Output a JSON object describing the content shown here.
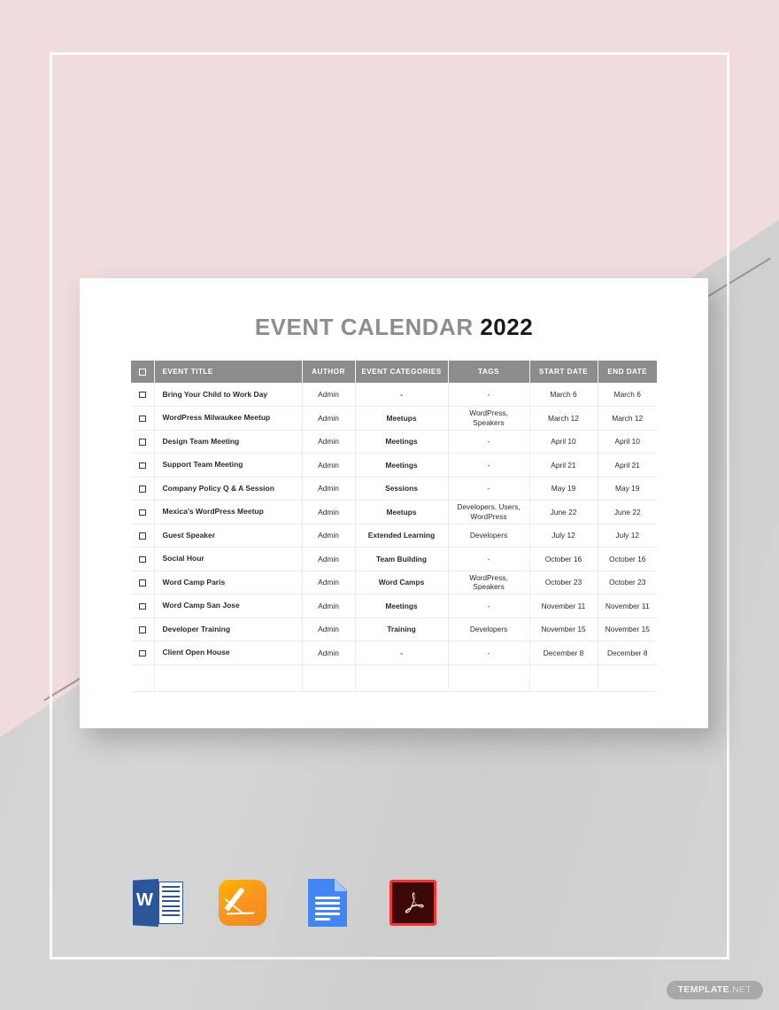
{
  "document": {
    "title_light": "EVENT CALENDAR",
    "title_dark": "2022"
  },
  "table": {
    "columns": [
      "EVENT TITLE",
      "AUTHOR",
      "EVENT CATEGORIES",
      "TAGS",
      "START DATE",
      "END DATE"
    ],
    "header_checkbox": "checkbox-unchecked",
    "rows": [
      {
        "title": "Bring Your Child to Work Day",
        "author": "Admin",
        "category": "-",
        "tags": "-",
        "start": "March 6",
        "end": "March 6"
      },
      {
        "title": "WordPress Milwaukee Meetup",
        "author": "Admin",
        "category": "Meetups",
        "tags": "WordPress, Speakers",
        "start": "March 12",
        "end": "March 12"
      },
      {
        "title": "Design Team Meeting",
        "author": "Admin",
        "category": "Meetings",
        "tags": "-",
        "start": "April 10",
        "end": "April 10"
      },
      {
        "title": "Support Team Meeting",
        "author": "Admin",
        "category": "Meetings",
        "tags": "-",
        "start": "April 21",
        "end": "April 21"
      },
      {
        "title": "Company Policy Q & A Session",
        "author": "Admin",
        "category": "Sessions",
        "tags": "-",
        "start": "May 19",
        "end": "May 19"
      },
      {
        "title": "Mexica's WordPress Meetup",
        "author": "Admin",
        "category": "Meetups",
        "tags": "Developers, Users, WordPress",
        "start": "June 22",
        "end": "June 22"
      },
      {
        "title": "Guest Speaker",
        "author": "Admin",
        "category": "Extended Learning",
        "tags": "Developers",
        "start": "July 12",
        "end": "July 12"
      },
      {
        "title": "Social Hour",
        "author": "Admin",
        "category": "Team Building",
        "tags": "-",
        "start": "October 16",
        "end": "October 16"
      },
      {
        "title": "Word Camp Paris",
        "author": "Admin",
        "category": "Word Camps",
        "tags": "WordPress, Speakers",
        "start": "October 23",
        "end": "October 23"
      },
      {
        "title": "Word Camp San Jose",
        "author": "Admin",
        "category": "Meetings",
        "tags": "-",
        "start": "November 11",
        "end": "November 11"
      },
      {
        "title": "Developer Training",
        "author": "Admin",
        "category": "Training",
        "tags": "Developers",
        "start": "November 15",
        "end": "November 15"
      },
      {
        "title": "Client Open House",
        "author": "Admin",
        "category": "-",
        "tags": "-",
        "start": "December 8",
        "end": "December 8"
      }
    ]
  },
  "format_icons": [
    {
      "name": "microsoft-word-icon",
      "label": "W"
    },
    {
      "name": "apple-pages-icon",
      "label": ""
    },
    {
      "name": "google-docs-icon",
      "label": ""
    },
    {
      "name": "adobe-pdf-icon",
      "label": ""
    }
  ],
  "watermark": {
    "strong": "TEMPLATE",
    "weak": ".NET"
  },
  "colors": {
    "background_pink": "#f0dcdc",
    "background_gray": "#d2d2d2",
    "table_header": "#8c8c8c",
    "title_light": "#8e8e8e",
    "title_dark": "#1a1a1a",
    "word_blue": "#2b579a",
    "pages_orange": "#f79421",
    "gdocs_blue": "#4285f4",
    "pdf_red": "#ee3733"
  }
}
